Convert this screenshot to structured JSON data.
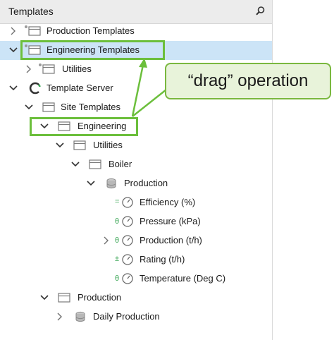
{
  "panel": {
    "title": "Templates",
    "search_icon": "search-icon"
  },
  "tree": [
    {
      "label": "Production Templates",
      "expanded": false,
      "icon": "template-folder-icon",
      "selected": false
    },
    {
      "label": "Engineering Templates",
      "expanded": true,
      "icon": "template-folder-icon",
      "selected": true
    },
    {
      "label": "Utilities",
      "expanded": false,
      "icon": "template-folder-icon",
      "selected": false
    },
    {
      "label": "Template Server",
      "expanded": true,
      "icon": "server-icon",
      "selected": false
    },
    {
      "label": "Site Templates",
      "expanded": true,
      "icon": "folder-icon",
      "selected": false
    },
    {
      "label": "Engineering",
      "expanded": true,
      "icon": "folder-icon",
      "selected": false
    },
    {
      "label": "Utilities",
      "expanded": true,
      "icon": "folder-icon",
      "selected": false
    },
    {
      "label": "Boiler",
      "expanded": true,
      "icon": "folder-icon",
      "selected": false
    },
    {
      "label": "Production",
      "expanded": true,
      "icon": "element-icon",
      "selected": false
    },
    {
      "label": "Efficiency (%)",
      "icon": "attribute-gauge-icon",
      "prefix": "=",
      "selected": false
    },
    {
      "label": "Pressure (kPa)",
      "icon": "attribute-gauge-icon",
      "prefix": "θ",
      "selected": false
    },
    {
      "label": "Production (t/h)",
      "expanded": false,
      "icon": "attribute-gauge-icon",
      "prefix": "θ",
      "selected": false
    },
    {
      "label": "Rating (t/h)",
      "icon": "attribute-gauge-icon",
      "prefix": "±",
      "selected": false
    },
    {
      "label": "Temperature (Deg C)",
      "icon": "attribute-gauge-icon",
      "prefix": "θ",
      "selected": false
    },
    {
      "label": "Production",
      "expanded": true,
      "icon": "folder-icon",
      "selected": false
    },
    {
      "label": "Daily Production",
      "expanded": false,
      "icon": "element-icon",
      "selected": false
    }
  ],
  "callout": {
    "text": "“drag” operation"
  },
  "colors": {
    "highlight": "#6cbf3c",
    "selection": "#cce4f7",
    "callout_fill": "#e8f3da"
  }
}
